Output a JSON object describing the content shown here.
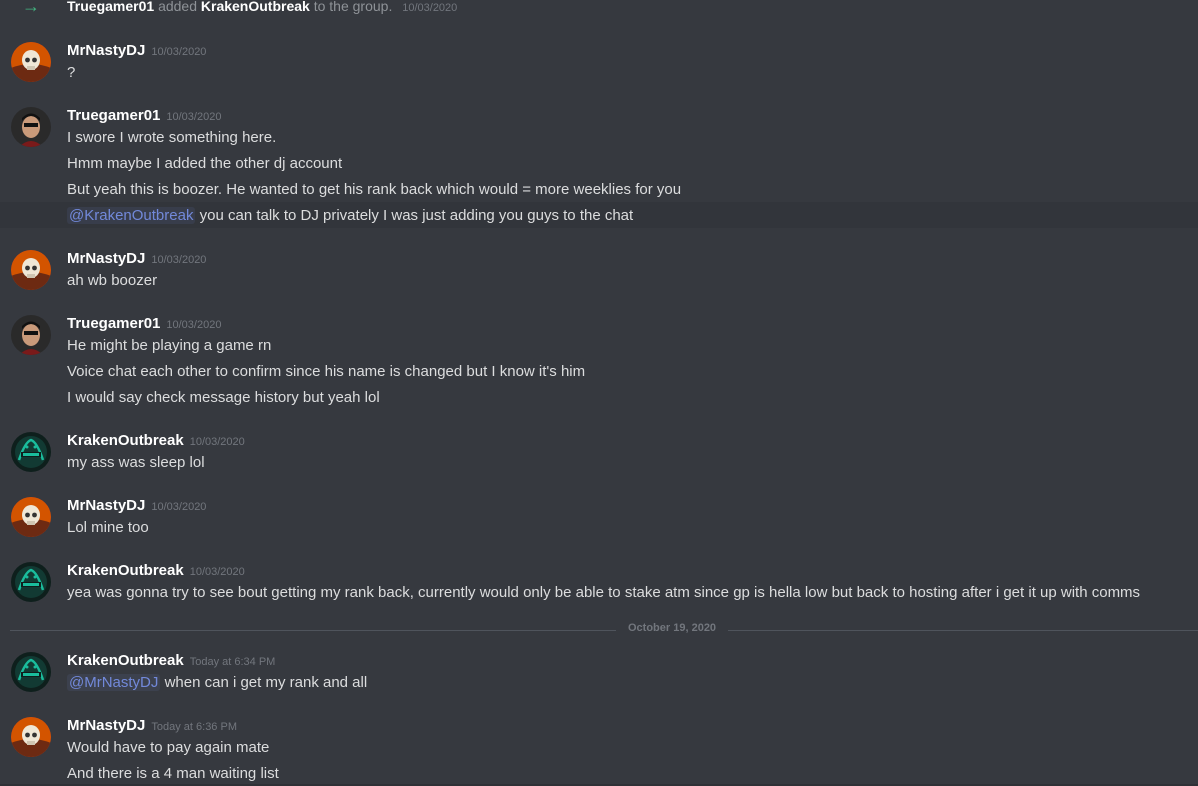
{
  "system_message": {
    "user1": "Truegamer01",
    "action": "added",
    "user2": "KrakenOutbreak",
    "suffix": "to the group.",
    "timestamp": "10/03/2020"
  },
  "messages": [
    {
      "author": "MrNastyDJ",
      "timestamp": "10/03/2020",
      "avatar": "skull-avatar",
      "lines": [
        "?"
      ]
    },
    {
      "author": "Truegamer01",
      "timestamp": "10/03/2020",
      "avatar": "man-avatar",
      "lines": [
        "I swore I wrote something here.",
        "Hmm maybe I added the other dj account",
        "But yeah this is boozer. He wanted to get his rank back which would = more weeklies for you"
      ],
      "mention_line": {
        "mention": "@KrakenOutbreak",
        "text": "you can talk to DJ privately I was just adding you guys to the chat"
      }
    },
    {
      "author": "MrNastyDJ",
      "timestamp": "10/03/2020",
      "avatar": "skull-avatar",
      "lines": [
        "ah wb boozer"
      ]
    },
    {
      "author": "Truegamer01",
      "timestamp": "10/03/2020",
      "avatar": "man-avatar",
      "lines": [
        "He might be playing a game rn",
        "Voice chat each other to confirm since his name is changed but I know it's him",
        "I would say check message history but yeah lol"
      ]
    },
    {
      "author": "KrakenOutbreak",
      "timestamp": "10/03/2020",
      "avatar": "kraken-avatar",
      "lines": [
        "my ass was sleep lol"
      ]
    },
    {
      "author": "MrNastyDJ",
      "timestamp": "10/03/2020",
      "avatar": "skull-avatar",
      "lines": [
        "Lol mine too"
      ]
    },
    {
      "author": "KrakenOutbreak",
      "timestamp": "10/03/2020",
      "avatar": "kraken-avatar",
      "lines": [
        "yea was gonna try to see bout getting my rank back, currently would only be able to stake atm since gp is hella low but back to hosting after i get it up with comms"
      ]
    },
    {
      "author": "KrakenOutbreak",
      "timestamp": "Today at 6:34 PM",
      "avatar": "kraken-avatar",
      "lines": [],
      "mention_line": {
        "mention": "@MrNastyDJ",
        "text": "when can i get my rank and all"
      }
    },
    {
      "author": "MrNastyDJ",
      "timestamp": "Today at 6:36 PM",
      "avatar": "skull-avatar",
      "lines": [
        "Would have to pay again mate",
        "And there is a 4 man waiting list"
      ]
    }
  ],
  "date_divider": "October 19, 2020",
  "colors": {
    "background": "#36393f",
    "username": "#ffffff",
    "text": "#dcddde",
    "timestamp": "#72767d",
    "mention": "#7289da",
    "join_arrow": "#43b581"
  }
}
